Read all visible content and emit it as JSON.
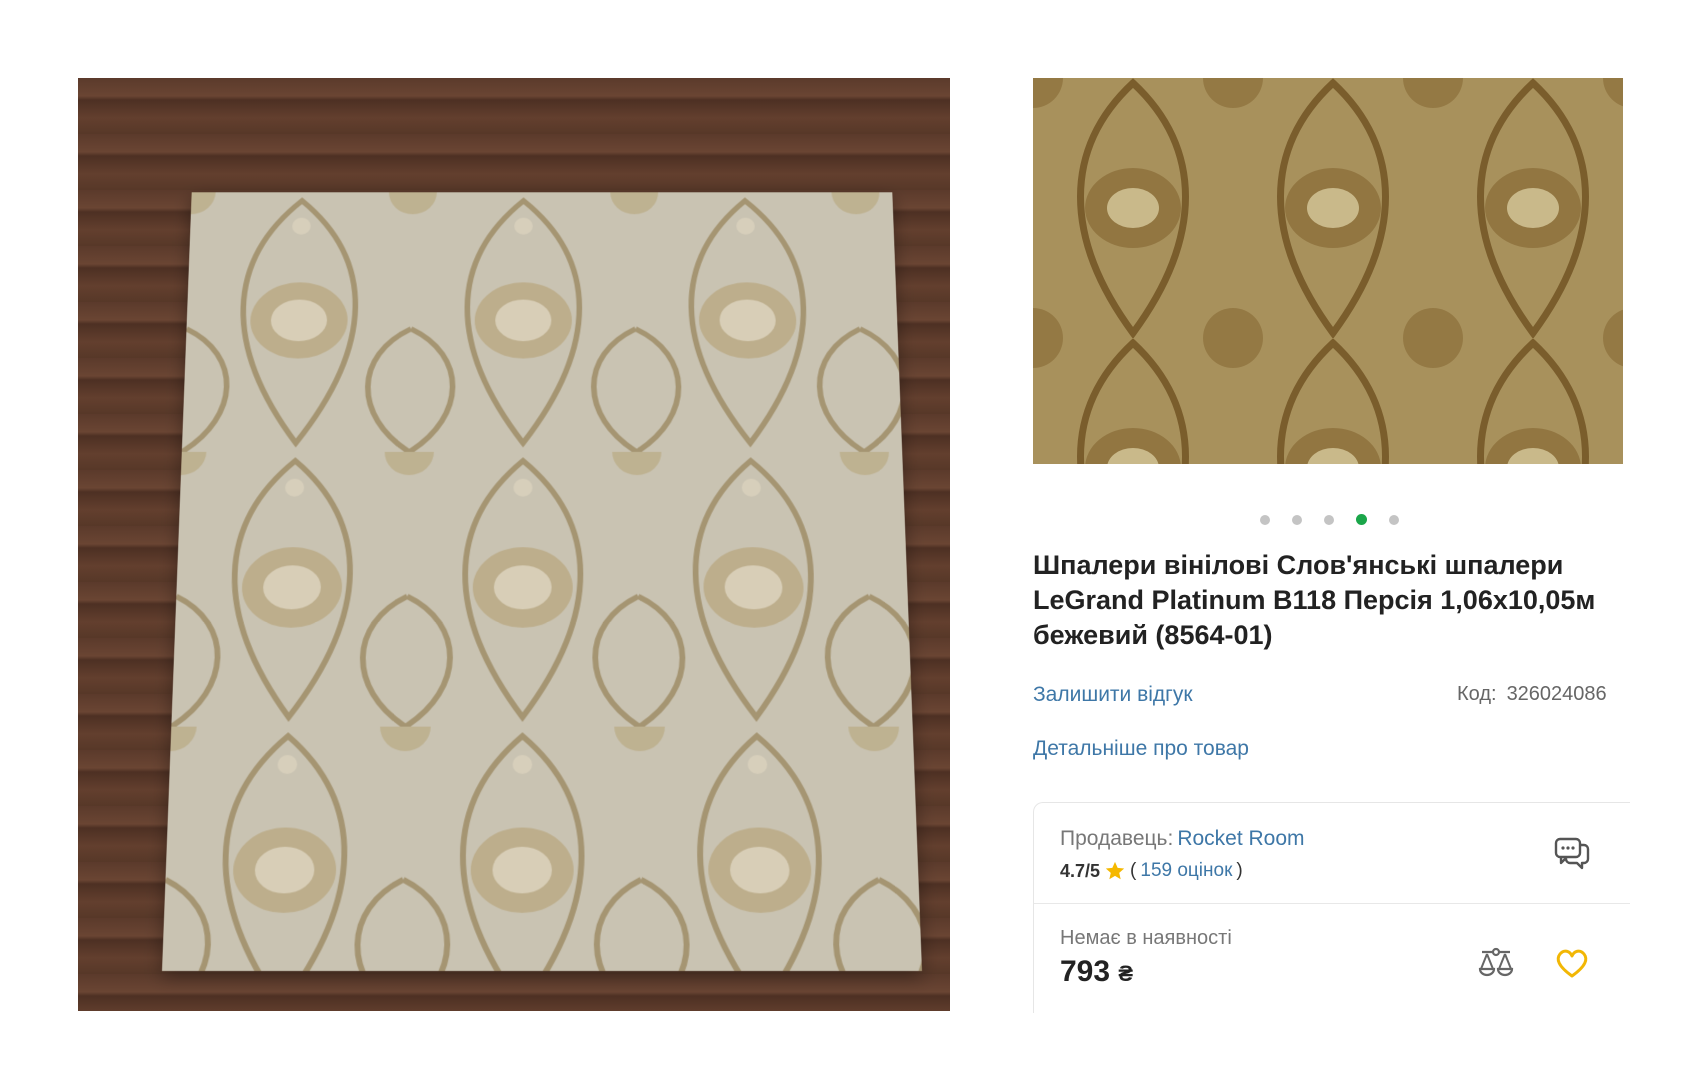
{
  "product": {
    "title": "Шпалери вінілові Слов'янські шпалери LeGrand Platinum B118 Персія 1,06х10,05м бежевий (8564-01)",
    "review_link": "Залишити відгук",
    "details_link": "Детальніше про товар",
    "code_label": "Код:",
    "code_value": "326024086"
  },
  "gallery": {
    "dot_count": 5,
    "active_index": 3
  },
  "seller": {
    "label": "Продавець:",
    "name": "Rocket Room",
    "rating": "4.7/5",
    "reviews_open": "(",
    "reviews": "159 оцінок",
    "reviews_close": ")"
  },
  "purchase": {
    "availability": "Немає в наявності",
    "price": "793",
    "currency": "₴"
  },
  "colors": {
    "link": "#3e77a7",
    "active_dot": "#1aa64a",
    "star": "#f5b800",
    "heart": "#f2b705"
  },
  "icons": [
    "chat-icon",
    "star-icon",
    "compare-icon",
    "heart-icon"
  ]
}
